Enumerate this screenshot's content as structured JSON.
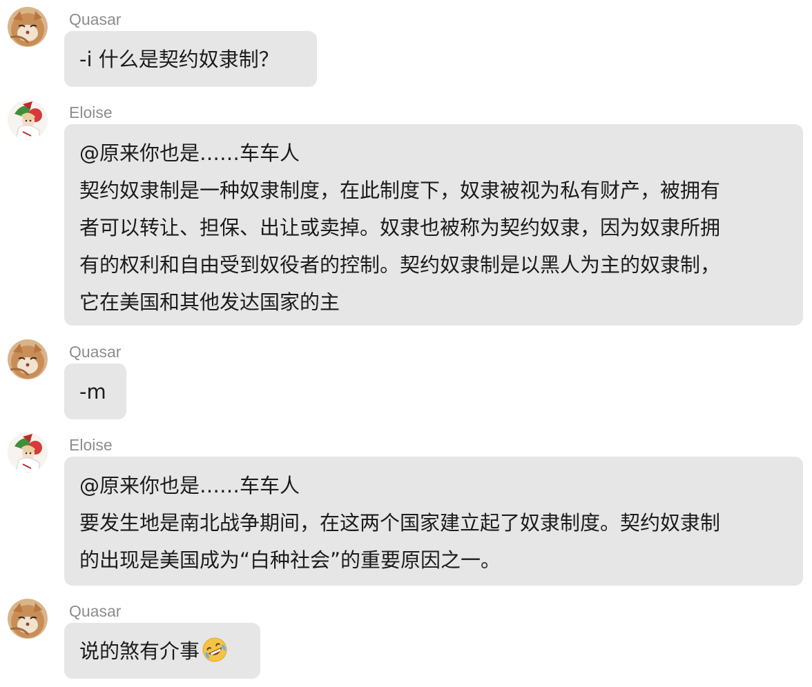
{
  "messages": [
    {
      "sender": "Quasar",
      "lines": [
        "-i 什么是契约奴隶制？"
      ]
    },
    {
      "sender": "Eloise",
      "lines": [
        "@原来你也是……车车人",
        "契约奴隶制是一种奴隶制度，在此制度下，奴隶被视为私有财产，被拥有",
        "者可以转让、担保、出让或卖掉。奴隶也被称为契约奴隶，因为奴隶所拥",
        "有的权利和自由受到奴役者的控制。契约奴隶制是以黑人为主的奴隶制，",
        "它在美国和其他发达国家的主"
      ]
    },
    {
      "sender": "Quasar",
      "lines": [
        "-m"
      ]
    },
    {
      "sender": "Eloise",
      "lines": [
        "@原来你也是……车车人",
        "要发生地是南北战争期间，在这两个国家建立起了奴隶制度。契约奴隶制",
        "的出现是美国成为“白种社会”的重要原因之一。"
      ]
    },
    {
      "sender": "Quasar",
      "lines": [
        "说的煞有介事"
      ],
      "emoji": "rolling-on-floor-laughing-emoji"
    }
  ],
  "colors": {
    "bubble": "#e6e6e6",
    "sender_name": "#8c8c8c",
    "text": "#1b1b1b"
  }
}
